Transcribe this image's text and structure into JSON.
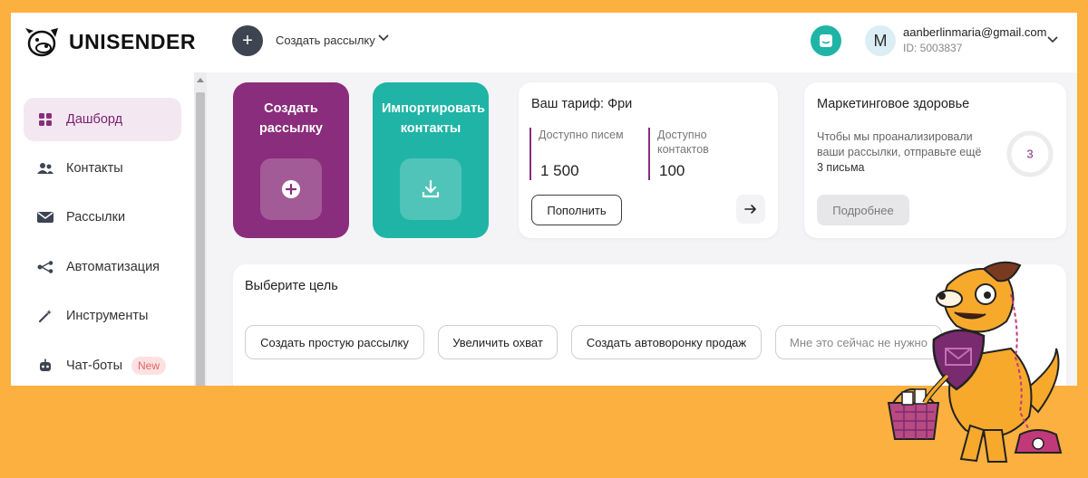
{
  "brand": {
    "name": "UNISENDER"
  },
  "header": {
    "create_label": "Создать рассылку",
    "user_initial": "M",
    "user_email": "aanberlinmaria@gmail.com",
    "user_id": "ID: 5003837"
  },
  "sidebar": {
    "items": [
      {
        "label": "Дашборд",
        "icon": "dashboard-icon",
        "active": true
      },
      {
        "label": "Контакты",
        "icon": "contacts-icon"
      },
      {
        "label": "Рассылки",
        "icon": "mail-icon"
      },
      {
        "label": "Автоматизация",
        "icon": "automation-icon"
      },
      {
        "label": "Инструменты",
        "icon": "magic-wand-icon"
      },
      {
        "label": "Чат-боты",
        "icon": "robot-icon",
        "badge": "New"
      }
    ]
  },
  "tiles": {
    "create": {
      "title": "Создать рассылку",
      "icon": "plus-icon"
    },
    "import": {
      "title": "Импортировать контакты",
      "icon": "download-icon"
    }
  },
  "tariff": {
    "title": "Ваш тариф: Фри",
    "emails_label": "Доступно писем",
    "emails_value": "1 500",
    "contacts_label": "Доступно контактов",
    "contacts_value": "100",
    "topup_label": "Пополнить"
  },
  "health": {
    "title": "Маркетинговое здоровье",
    "text": "Чтобы мы проанализировали ваши рассылки, отправьте ещё",
    "text_strong": "3 письма",
    "ring_value": "3",
    "more_label": "Подробнее"
  },
  "goal": {
    "title": "Выберите цель",
    "options": [
      "Создать простую рассылку",
      "Увеличить охват",
      "Создать автоворонку продаж",
      "Мне это сейчас не нужно"
    ]
  },
  "colors": {
    "background": "#fbb03f",
    "brand_purple": "#8a2d7c",
    "brand_teal": "#1fb4a6"
  }
}
